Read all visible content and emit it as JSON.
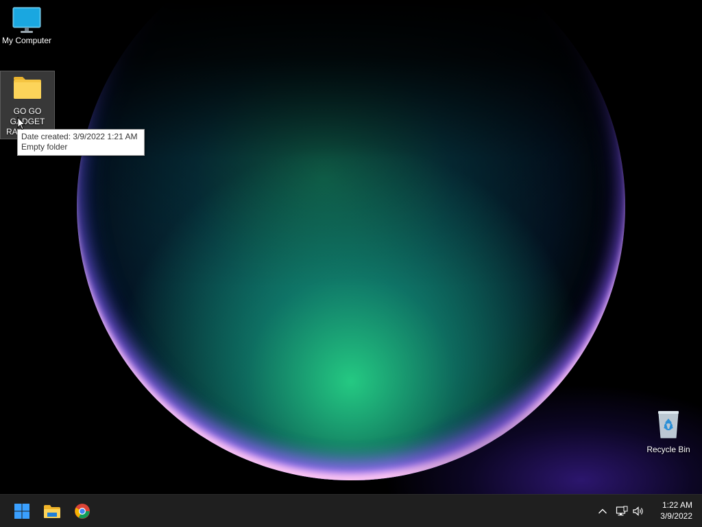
{
  "desktop": {
    "icons": [
      {
        "label": "My Computer"
      },
      {
        "label_lines": [
          "GO GO",
          "GADGET",
          "RA…"
        ]
      },
      {
        "label": "Recycle Bin"
      }
    ]
  },
  "tooltip": {
    "line1": "Date created: 3/9/2022 1:21 AM",
    "line2": "Empty folder"
  },
  "taskbar": {
    "apps": [
      {
        "icon": "windows-start-icon"
      },
      {
        "icon": "file-explorer-icon"
      },
      {
        "icon": "chrome-icon"
      }
    ],
    "tray": {
      "icons": [
        "chevron-up-icon",
        "network-icon",
        "volume-icon"
      ],
      "time": "1:22 AM",
      "date": "3/9/2022"
    }
  },
  "colors": {
    "taskbar_bg": "#1f1f1f",
    "folder_yellow": "#f5c542",
    "start_blue": "#1e90ff"
  }
}
